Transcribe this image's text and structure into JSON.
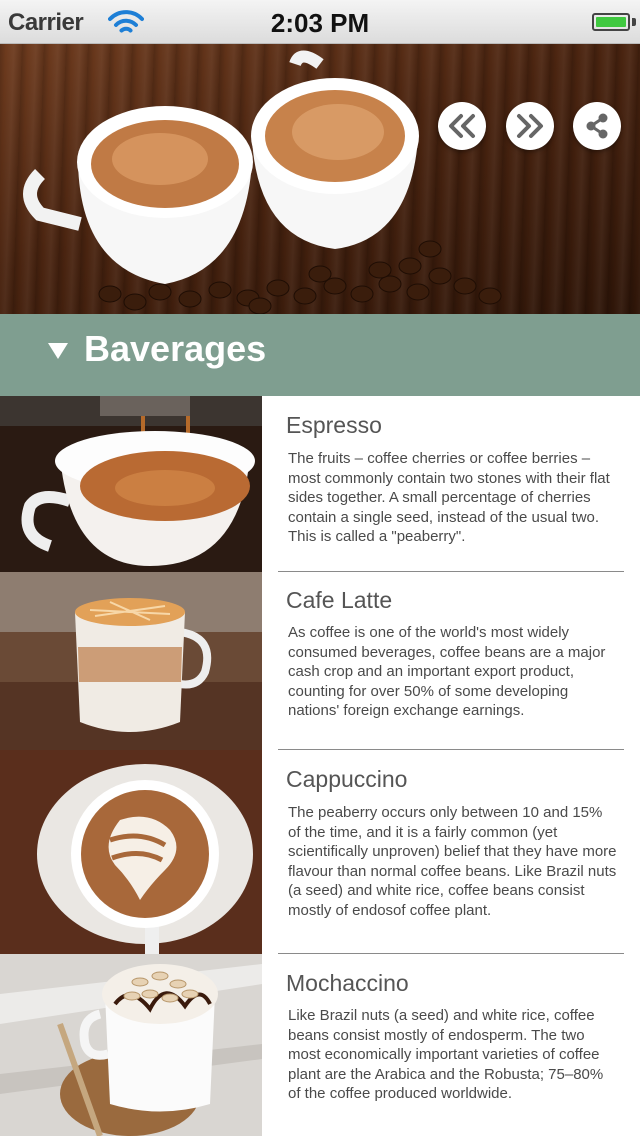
{
  "status_bar": {
    "carrier": "Carrier",
    "time": "2:03 PM",
    "battery_level": 1.0
  },
  "hero": {
    "buttons": [
      {
        "name": "rewind-button",
        "icon": "double-chevron-left-icon"
      },
      {
        "name": "forward-button",
        "icon": "double-chevron-right-icon"
      },
      {
        "name": "share-button",
        "icon": "share-icon"
      }
    ]
  },
  "section": {
    "title": "Baverages",
    "icon": "triangle-down-icon"
  },
  "items": [
    {
      "title": "Espresso",
      "description": "The fruits – coffee cherries or coffee berries – most commonly contain two stones with their flat sides together. A small percentage of cherries contain a single seed, instead of the usual two. This is called a \"peaberry\"."
    },
    {
      "title": "Cafe Latte",
      "description": "As coffee is one of the world's most widely consumed beverages, coffee beans are a major cash crop and an important export product, counting for over 50% of some developing nations' foreign exchange earnings."
    },
    {
      "title": "Cappuccino",
      "description": "The peaberry occurs only between 10 and 15% of the time, and it is a fairly common (yet scientifically unproven) belief that they have more flavour than normal coffee beans. Like Brazil nuts (a seed) and white rice, coffee beans consist mostly of endosof coffee plant."
    },
    {
      "title": "Mochaccino",
      "description": "Like Brazil nuts (a seed) and white rice, coffee beans consist mostly of endosperm. The two most economically important varieties of coffee plant are the Arabica and the Robusta; 75–80% of the coffee produced worldwide."
    }
  ],
  "colors": {
    "section_band": "#7f9e90",
    "battery": "#3fc83f"
  }
}
